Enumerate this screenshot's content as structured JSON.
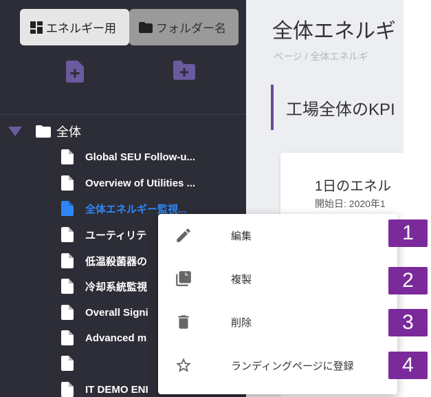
{
  "sidebar": {
    "tabs": [
      {
        "label": "エネルギー用"
      },
      {
        "label": "フォルダー名"
      }
    ],
    "tree": {
      "root_label": "全体",
      "items": [
        {
          "label": "Global SEU Follow-u..."
        },
        {
          "label": "Overview of Utilities ..."
        },
        {
          "label": "全体エネルギー監視..."
        },
        {
          "label": "ユーティリテ"
        },
        {
          "label": "低温殺菌器の"
        },
        {
          "label": "冷却系統監視"
        },
        {
          "label": "Overall Signi"
        },
        {
          "label": "Advanced m"
        },
        {
          "label": ""
        },
        {
          "label": "IT DEMO ENI"
        }
      ]
    }
  },
  "main": {
    "title": "全体エネルギ",
    "breadcrumb": "ページ / 全体エネルギ",
    "section_title": "工場全体のKPI",
    "card": {
      "title": "1日のエネル",
      "subtitle": "開始日: 2020年1"
    }
  },
  "context_menu": {
    "items": [
      {
        "label": "編集",
        "icon": "pencil-icon"
      },
      {
        "label": "複製",
        "icon": "copy-icon"
      },
      {
        "label": "削除",
        "icon": "trash-icon"
      },
      {
        "label": "ランディングページに登録",
        "icon": "star-outline-icon"
      }
    ]
  },
  "callouts": [
    "1",
    "2",
    "3",
    "4"
  ],
  "colors": {
    "sidebar_bg": "#2c2d36",
    "accent_purple": "#6a5a9e",
    "selected_blue": "#2e86f6",
    "callout_purple": "#7b2a9b"
  }
}
